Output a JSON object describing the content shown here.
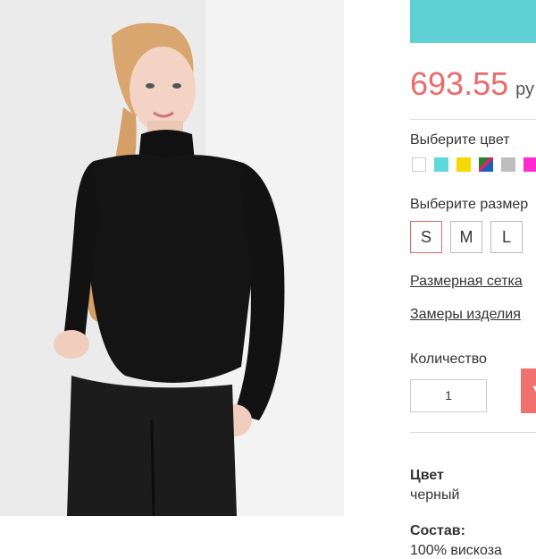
{
  "product": {
    "image_alt": "",
    "price": "693.55",
    "currency": "ру"
  },
  "color_select": {
    "label": "Выберите цвет",
    "swatches": [
      {
        "name": "white",
        "color": "#ffffff"
      },
      {
        "name": "turquoise",
        "color": "#5fd8dc"
      },
      {
        "name": "yellow",
        "color": "#f5d800"
      },
      {
        "name": "multicolor",
        "color": "#3a8f3a"
      },
      {
        "name": "grey",
        "color": "#bdbdbd"
      },
      {
        "name": "magenta",
        "color": "#ff2ad0"
      }
    ]
  },
  "size_select": {
    "label": "Выберите размер",
    "options": [
      "S",
      "M",
      "L"
    ],
    "selected": "S"
  },
  "links": {
    "size_chart": "Размерная сетка",
    "measurements": "Замеры изделия"
  },
  "quantity": {
    "label": "Количество",
    "value": "1"
  },
  "cart_button": {
    "icon": "cart-icon"
  },
  "details": {
    "color_title": "Цвет",
    "color_value": "черный",
    "composition_title": "Состав:",
    "composition_value": "100% вискоза"
  }
}
